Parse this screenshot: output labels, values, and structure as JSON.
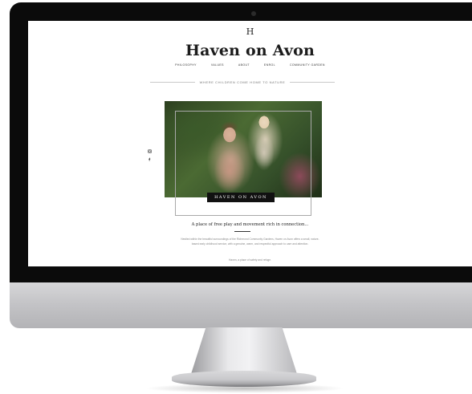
{
  "site": {
    "logo_mark": "H",
    "title": "Haven on Avon",
    "tagline": "Where children come home to nature"
  },
  "nav": {
    "items": [
      {
        "label": "Philosophy"
      },
      {
        "label": "Values"
      },
      {
        "label": "About"
      },
      {
        "label": "Enrol"
      },
      {
        "label": "Community Garden"
      }
    ]
  },
  "social": {
    "icons": [
      "instagram-icon",
      "facebook-icon"
    ]
  },
  "hero": {
    "caption": "HAVEN ON AVON"
  },
  "intro": {
    "headline": "A place of free play and movement rich in connection...",
    "body": "Nestled within the beautiful surroundings of the Richmond Community Gardens, Haven on Avon offers a small, nature-based early childhood service, with a genuine, warm, and respectful approach to care and attention.",
    "closing": "Haven, a place of safety and refuge."
  },
  "colors": {
    "bezel": "#0b0b0b",
    "text_dark": "#1c1c1c",
    "caption_bg": "#111111"
  }
}
